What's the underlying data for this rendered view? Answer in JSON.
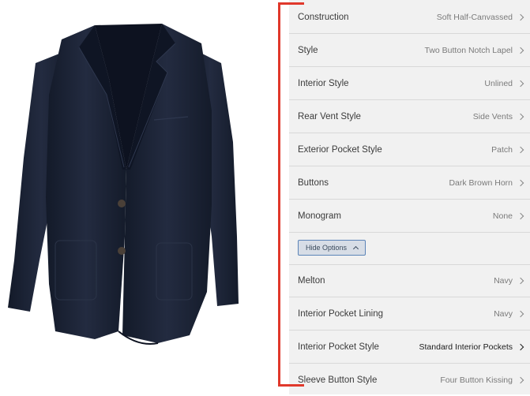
{
  "options": [
    {
      "label": "Construction",
      "value": "Soft Half-Canvassed"
    },
    {
      "label": "Style",
      "value": "Two Button Notch Lapel"
    },
    {
      "label": "Interior Style",
      "value": "Unlined"
    },
    {
      "label": "Rear Vent Style",
      "value": "Side Vents"
    },
    {
      "label": "Exterior Pocket Style",
      "value": "Patch"
    },
    {
      "label": "Buttons",
      "value": "Dark Brown Horn"
    },
    {
      "label": "Monogram",
      "value": "None"
    }
  ],
  "hide_options_label": "Hide Options",
  "extra_options": [
    {
      "label": "Melton",
      "value": "Navy"
    },
    {
      "label": "Interior Pocket Lining",
      "value": "Navy"
    },
    {
      "label": "Interior Pocket Style",
      "value": "Standard Interior Pockets"
    },
    {
      "label": "Sleeve Button Style",
      "value": "Four Button Kissing"
    }
  ],
  "colors": {
    "jacket": "#1d2436",
    "panel_bg": "#f1f1f1",
    "highlight_bracket": "#e0382b",
    "button_border": "#5b84b8"
  }
}
